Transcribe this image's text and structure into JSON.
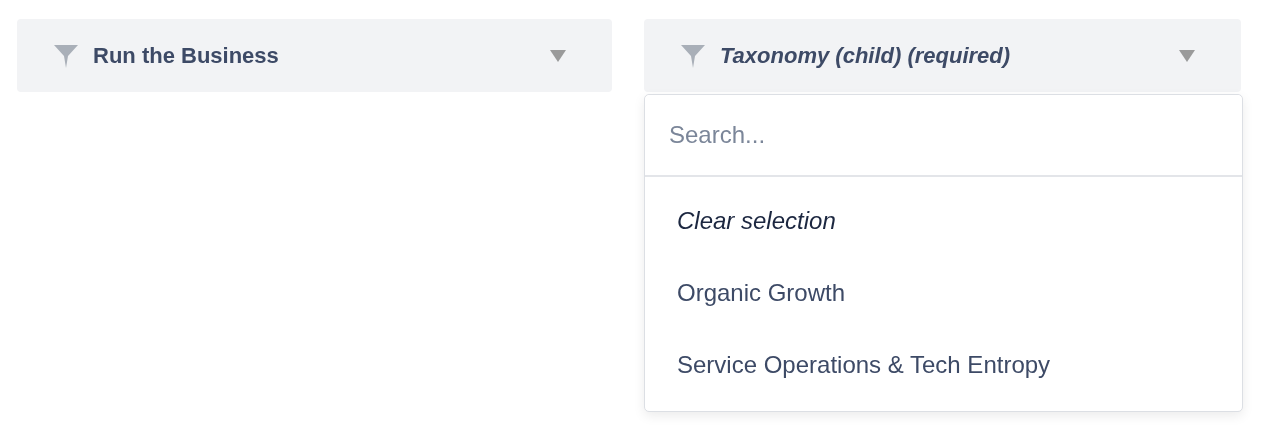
{
  "filters": [
    {
      "label": "Run the Business",
      "kind": "value"
    },
    {
      "label": "Taxonomy (child) (required)",
      "kind": "placeholder",
      "dropdown": {
        "search": {
          "placeholder": "Search..."
        },
        "options": [
          {
            "label": "Clear selection",
            "kind": "clear"
          },
          {
            "label": "Organic Growth",
            "kind": "option"
          },
          {
            "label": "Service Operations & Tech Entropy",
            "kind": "option"
          }
        ]
      }
    }
  ]
}
